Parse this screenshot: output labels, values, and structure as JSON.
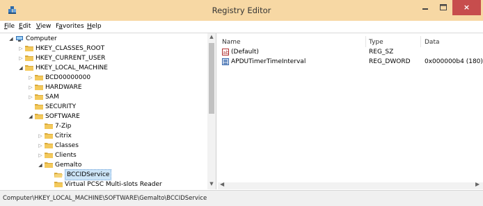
{
  "window": {
    "title": "Registry Editor",
    "close_glyph": "×",
    "title_bar_color": "#f7d8a4",
    "close_button_color": "#c74d4d"
  },
  "menu": [
    {
      "hotkey": "F",
      "rest": "ile"
    },
    {
      "hotkey": "E",
      "rest": "dit"
    },
    {
      "hotkey": "V",
      "rest": "iew"
    },
    {
      "prefix": "F",
      "hotkey": "a",
      "rest": "vorites"
    },
    {
      "hotkey": "H",
      "rest": "elp"
    }
  ],
  "tree": [
    {
      "label": "Computer",
      "expander": "open",
      "icon": "computer-icon"
    },
    {
      "label": "HKEY_CLASSES_ROOT",
      "expander": "closed",
      "icon": "folder-icon"
    },
    {
      "label": "HKEY_CURRENT_USER",
      "expander": "closed",
      "icon": "folder-icon"
    },
    {
      "label": "HKEY_LOCAL_MACHINE",
      "expander": "open",
      "icon": "folder-icon"
    },
    {
      "label": "BCD00000000",
      "expander": "closed",
      "icon": "folder-icon"
    },
    {
      "label": "HARDWARE",
      "expander": "closed",
      "icon": "folder-icon"
    },
    {
      "label": "SAM",
      "expander": "closed",
      "icon": "folder-icon"
    },
    {
      "label": "SECURITY",
      "expander": "none",
      "icon": "folder-icon"
    },
    {
      "label": "SOFTWARE",
      "expander": "open",
      "icon": "folder-icon"
    },
    {
      "label": "7-Zip",
      "expander": "none",
      "icon": "folder-icon"
    },
    {
      "label": "Citrix",
      "expander": "closed",
      "icon": "folder-icon"
    },
    {
      "label": "Classes",
      "expander": "closed",
      "icon": "folder-icon"
    },
    {
      "label": "Clients",
      "expander": "closed",
      "icon": "folder-icon"
    },
    {
      "label": "Gemalto",
      "expander": "open",
      "icon": "folder-icon"
    },
    {
      "label": "BCCIDService",
      "expander": "none",
      "icon": "folder-open-icon",
      "selected": true
    },
    {
      "label": "Virtual PCSC Multi-slots Reader",
      "expander": "none",
      "icon": "folder-icon"
    }
  ],
  "columns": {
    "name": "Name",
    "type": "Type",
    "data": "Data"
  },
  "values": [
    {
      "name": "(Default)",
      "type": "REG_SZ",
      "data": "",
      "icon": "string-value-icon"
    },
    {
      "name": "APDUTimerTimeInterval",
      "type": "REG_DWORD",
      "data": "0x000000b4 (180)",
      "icon": "binary-value-icon"
    }
  ],
  "status": {
    "path": "Computer\\HKEY_LOCAL_MACHINE\\SOFTWARE\\Gemalto\\BCCIDService"
  }
}
